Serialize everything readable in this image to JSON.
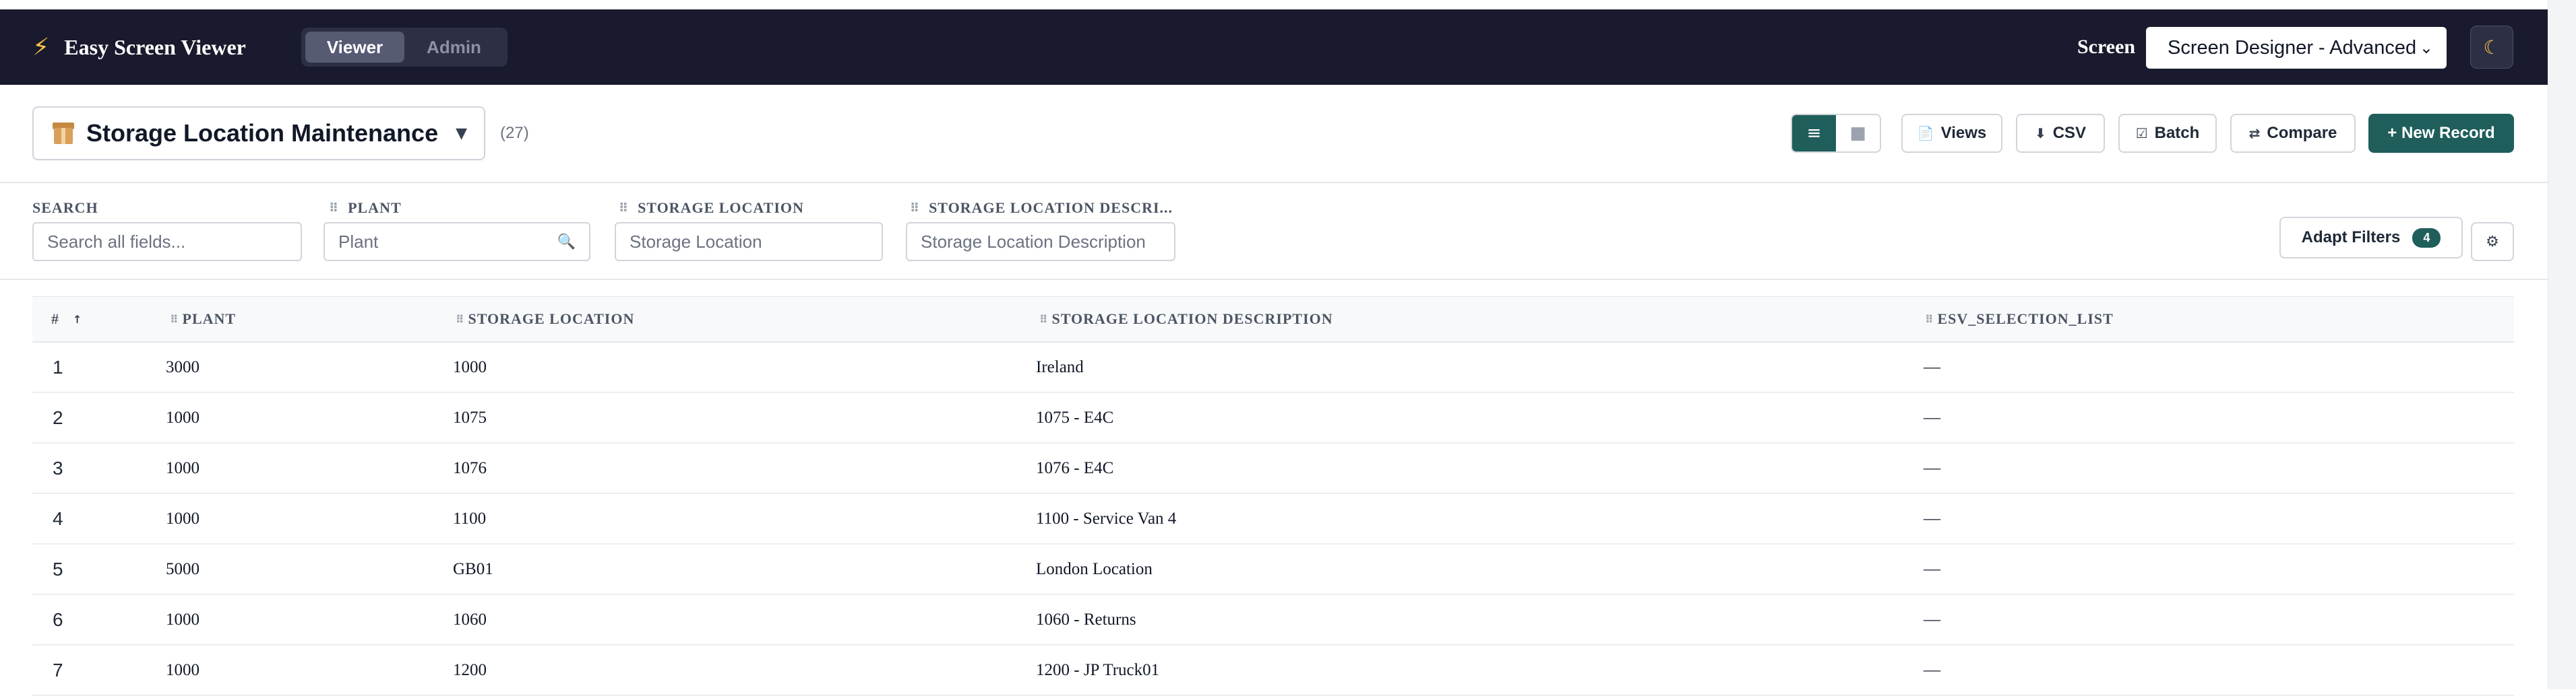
{
  "app": {
    "title": "Easy Screen Viewer",
    "logo_icon": "lightning-bolt",
    "modes": [
      "Viewer",
      "Admin"
    ],
    "active_mode": "Viewer",
    "screen_label": "Screen",
    "screen_value": "Screen Designer - Advanced",
    "theme_icon": "moon-icon"
  },
  "page": {
    "icon": "package-box",
    "title": "Storage Location Maintenance",
    "record_count": "(27)"
  },
  "toolbar": {
    "views_label": "Views",
    "csv_label": "CSV",
    "batch_label": "Batch",
    "compare_label": "Compare",
    "new_record_label": "+ New Record",
    "view_modes": [
      "list",
      "grid"
    ],
    "active_view": "list"
  },
  "filters": {
    "search": {
      "label": "SEARCH",
      "placeholder": "Search all fields..."
    },
    "plant": {
      "label": "PLANT",
      "placeholder": "Plant"
    },
    "storage_location": {
      "label": "STORAGE LOCATION",
      "placeholder": "Storage Location"
    },
    "storage_location_description": {
      "label": "STORAGE LOCATION DESCRI...",
      "placeholder": "Storage Location Description"
    },
    "adapt_label": "Adapt Filters",
    "adapt_count": "4"
  },
  "table": {
    "columns": [
      "#",
      "PLANT",
      "STORAGE LOCATION",
      "STORAGE LOCATION DESCRIPTION",
      "ESV_SELECTION_LIST"
    ],
    "sort_column": "#",
    "sort_direction": "ascending",
    "rows": [
      [
        "1",
        "3000",
        "1000",
        "Ireland",
        "—"
      ],
      [
        "2",
        "1000",
        "1075",
        "1075 - E4C",
        "—"
      ],
      [
        "3",
        "1000",
        "1076",
        "1076 - E4C",
        "—"
      ],
      [
        "4",
        "1000",
        "1100",
        "1100 - Service Van 4",
        "—"
      ],
      [
        "5",
        "5000",
        "GB01",
        "London Location",
        "—"
      ],
      [
        "6",
        "1000",
        "1060",
        "1060 - Returns",
        "—"
      ],
      [
        "7",
        "1000",
        "1200",
        "1200 - JP Truck01",
        "—"
      ]
    ]
  },
  "colors": {
    "topbar": "#1a1a2e",
    "accent": "#1f5e5b",
    "bolt": "#f6c344"
  }
}
